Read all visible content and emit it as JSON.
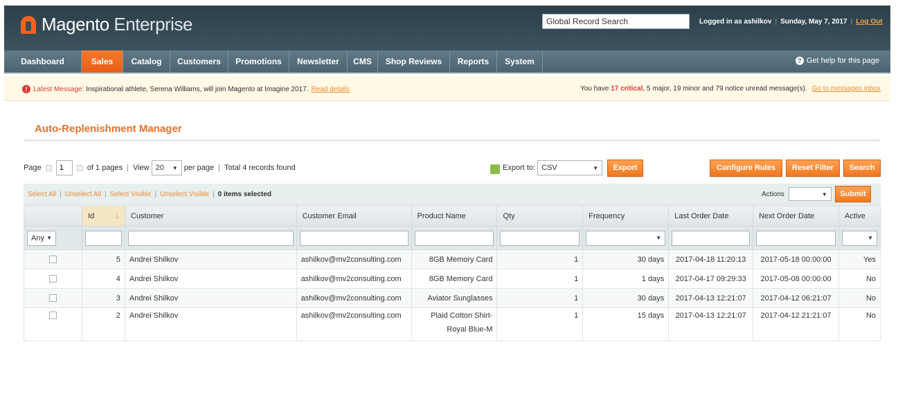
{
  "header": {
    "brand": "Magento",
    "brand_suffix": "Enterprise",
    "search_value": "Global Record Search",
    "logged_in": "Logged in as ashilkov",
    "date": "Sunday, May 7, 2017",
    "logout": "Log Out"
  },
  "nav": {
    "items": [
      "Dashboard",
      "Sales",
      "Catalog",
      "Customers",
      "Promotions",
      "Newsletter",
      "CMS",
      "Shop Reviews",
      "Reports",
      "System"
    ],
    "active": "Sales",
    "help": "Get help for this page"
  },
  "message": {
    "label": "Latest Message:",
    "text": "Inspirational athlete, Serena Williams, will join Magento at Imagine 2017.",
    "link": "Read details",
    "right_prefix": "You have",
    "critical": "17 critical",
    "right_rest": ", 5 major, 19 minor and 79 notice unread message(s).",
    "right_link": "Go to messages inbox"
  },
  "page": {
    "title": "Auto-Replenishment Manager"
  },
  "pager": {
    "page_label": "Page",
    "page_value": "1",
    "of_pages": "of 1 pages",
    "view_label": "View",
    "view_value": "20",
    "per_page": "per page",
    "total": "Total 4 records found"
  },
  "export": {
    "label": "Export to:",
    "format": "CSV",
    "button": "Export"
  },
  "buttons": {
    "configure": "Configure Rules",
    "reset": "Reset Filter",
    "search": "Search"
  },
  "massaction": {
    "select_all": "Select All",
    "unselect_all": "Unselect All",
    "select_visible": "Select Visible",
    "unselect_visible": "Unselect Visible",
    "selected": "0 items selected",
    "actions_label": "Actions",
    "submit": "Submit"
  },
  "grid": {
    "columns": [
      "",
      "Id",
      "Customer",
      "Customer Email",
      "Product Name",
      "Qty",
      "Frequency",
      "Last Order Date",
      "Next Order Date",
      "Active"
    ],
    "filter_any": "Any",
    "rows": [
      {
        "id": "5",
        "customer": "Andrei Shilkov",
        "email": "ashilkov@mv2consulting.com",
        "product": "8GB Memory Card",
        "product2": "",
        "qty": "1",
        "frequency": "30 days",
        "last": "2017-04-18 11:20:13",
        "next": "2017-05-18 00:00:00",
        "active": "Yes"
      },
      {
        "id": "4",
        "customer": "Andrei Shilkov",
        "email": "ashilkov@mv2consulting.com",
        "product": "8GB Memory Card",
        "product2": "",
        "qty": "1",
        "frequency": "1 days",
        "last": "2017-04-17 09:29:33",
        "next": "2017-05-08 00:00:00",
        "active": "No"
      },
      {
        "id": "3",
        "customer": "Andrei Shilkov",
        "email": "ashilkov@mv2consulting.com",
        "product": "Aviator Sunglasses",
        "product2": "",
        "qty": "1",
        "frequency": "30 days",
        "last": "2017-04-13 12:21:07",
        "next": "2017-04-12 06:21:07",
        "active": "No"
      },
      {
        "id": "2",
        "customer": "Andrei Shilkov",
        "email": "ashilkov@mv2consulting.com",
        "product": "Plaid Cotton Shirt-",
        "product2": "Royal Blue-M",
        "qty": "1",
        "frequency": "15 days",
        "last": "2017-04-13 12:21:07",
        "next": "2017-04-12 21:21:07",
        "active": "No"
      }
    ]
  },
  "colors": {
    "accent": "#f0781e",
    "header": "#2c3f49",
    "nav": "#4c6572"
  }
}
